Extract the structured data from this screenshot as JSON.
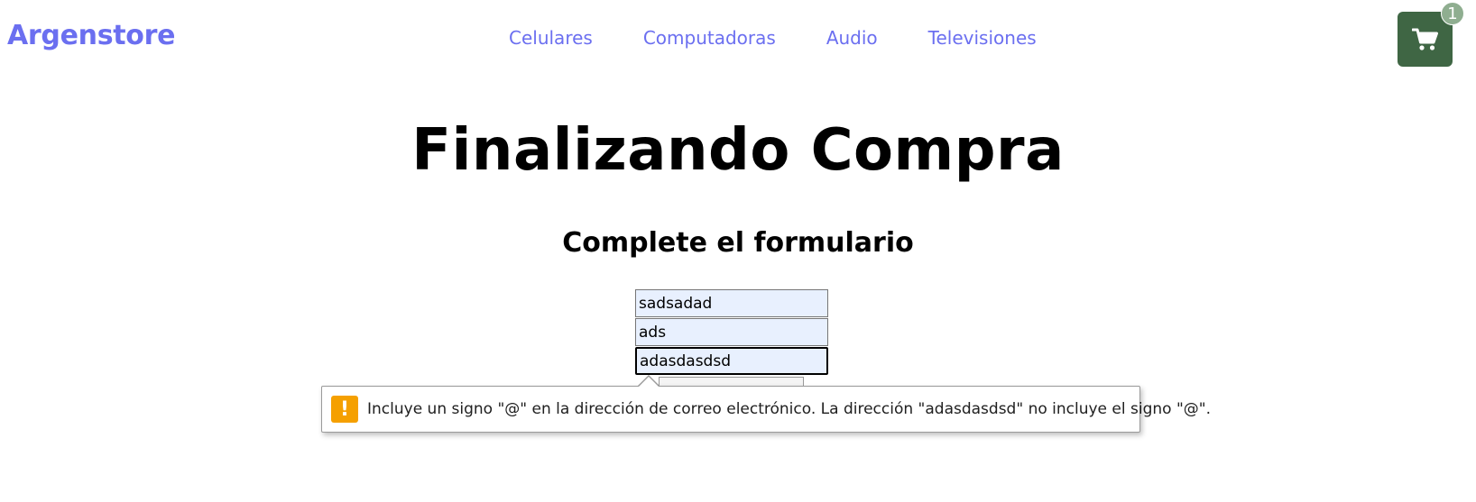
{
  "navbar": {
    "brand": "Argenstore",
    "links": [
      "Celulares",
      "Computadoras",
      "Audio",
      "Televisiones"
    ],
    "cart_icon": "shopping-cart-icon",
    "cart_count": "1"
  },
  "main": {
    "title": "Finalizando Compra",
    "form_heading": "Complete el formulario",
    "fields": [
      {
        "value": "sadsadad"
      },
      {
        "value": "ads"
      },
      {
        "value": "adasdasdsd"
      }
    ]
  },
  "validation": {
    "icon": "warning-icon",
    "icon_glyph": "!",
    "message": "Incluye un signo \"@\" en la dirección de correo electrónico. La dirección \"adasdasdsd\" no incluye el signo \"@\"."
  },
  "colors": {
    "brand": "#6b6ff0",
    "cart_button": "#3f6644",
    "cart_badge": "#8fae90",
    "input_autofill": "#e8f0fe",
    "warning": "#f5a000"
  }
}
